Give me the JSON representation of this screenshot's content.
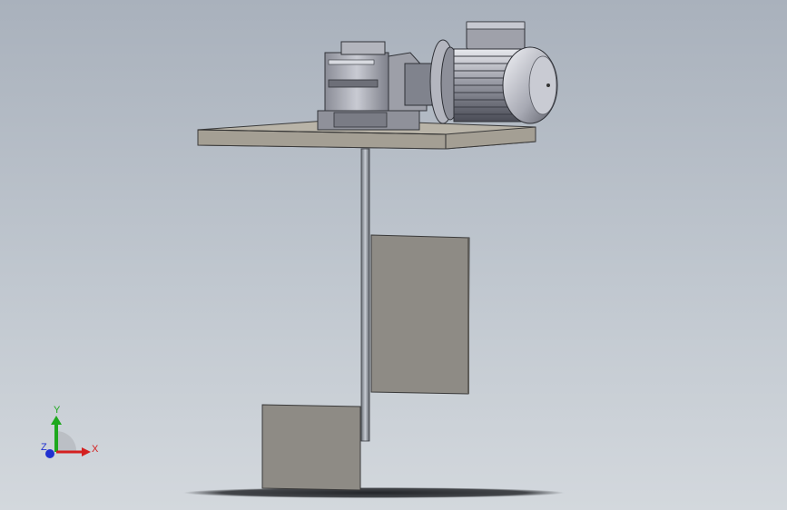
{
  "viewport": {
    "background_top": "#a9b1bc",
    "background_bottom": "#d3d8dd"
  },
  "triad": {
    "x_label": "X",
    "y_label": "Y",
    "z_label": "Z",
    "x_color": "#d42020",
    "y_color": "#1ea81e",
    "z_color": "#2030d0"
  },
  "model": {
    "parts": [
      "platform",
      "gear-reducer",
      "motor",
      "shaft",
      "paddle-upper",
      "paddle-lower"
    ],
    "face_color": "#8e8b85",
    "platform_color": "#b9b4a8"
  }
}
